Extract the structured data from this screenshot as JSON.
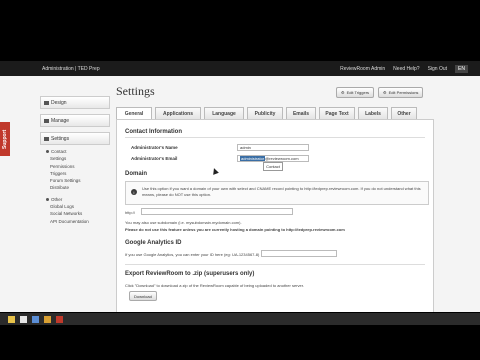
{
  "topbar": {
    "breadcrumb": "Administration | TED Prep",
    "user": "ReviewRoom Admin",
    "help": "Need Help?",
    "signout": "Sign Out",
    "lang": "EN"
  },
  "support_tab": "Support",
  "sidebar": {
    "items": [
      {
        "label": "Design"
      },
      {
        "label": "Manage"
      },
      {
        "label": "Settings"
      }
    ],
    "settings_sub": [
      "Contact",
      "Settings",
      "Permissions",
      "Triggers",
      "Forum Settings",
      "Distribute"
    ],
    "other_head": "Other",
    "other_sub": [
      "Global Logs",
      "Social Networks",
      "API Documentation"
    ]
  },
  "page": {
    "title": "Settings",
    "edit_triggers": "Edit Triggers",
    "edit_permissions": "Edit Permissions"
  },
  "tabs": [
    "General",
    "Applications",
    "Language",
    "Publicity",
    "Emails",
    "Page Text",
    "Labels",
    "Other"
  ],
  "contact": {
    "heading": "Contact Information",
    "name_label": "Administrator's Name",
    "name_value": "admin",
    "email_label": "Administrator's Email",
    "email_selected": "administrator",
    "email_rest": "@reviewroom.com",
    "popup": "Contact"
  },
  "domain": {
    "heading": "Domain",
    "info": "Use this option if you want a domain of your own with select and CNAME record pointing to http://tedprep.reviewroom.com. If you do not understand what this means, please do NOT use this option.",
    "url_label": "http://",
    "note1": "You may also use subdomain (i.e. mysubdomain.mydomain.com).",
    "note2": "Please do not use this feature unless you are currently hosting a domain pointing to http://tedprep.reviewroom.com"
  },
  "analytics": {
    "heading": "Google Analytics ID",
    "help": "If you use Google Analytics, you can enter your ID here (eg: UA-1234567-8)"
  },
  "export": {
    "heading": "Export ReviewRoom to .zip (superusers only)",
    "help": "Click \"Download\" to download a zip of the ReviewRoom capable of being uploaded to another server.",
    "button": "Download"
  }
}
